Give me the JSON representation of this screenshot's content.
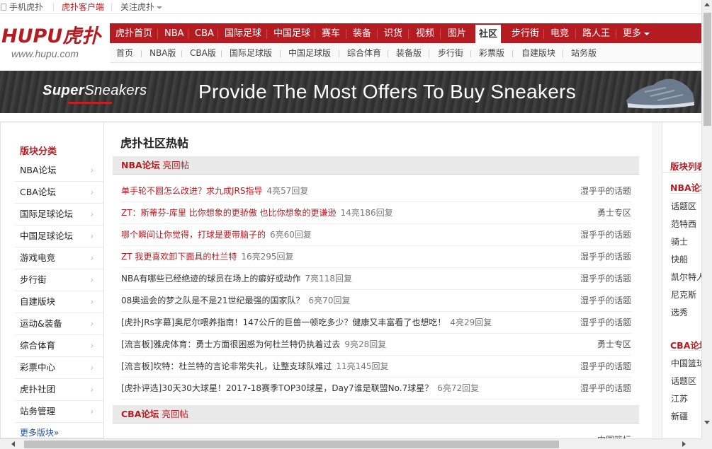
{
  "topbar": {
    "mobile": "手机虎扑",
    "client": "虎扑客户端",
    "follow": "关注虎扑"
  },
  "logo": {
    "main": "HUPU虎扑",
    "url": "www.hupu.com"
  },
  "nav_main": [
    {
      "label": "虎扑首页"
    },
    {
      "label": "NBA"
    },
    {
      "label": "CBA"
    },
    {
      "label": "国际足球"
    },
    {
      "label": "中国足球"
    },
    {
      "label": "赛车"
    },
    {
      "label": "装备"
    },
    {
      "label": "识货"
    },
    {
      "label": "视频"
    },
    {
      "label": "图片"
    },
    {
      "label": "社区"
    },
    {
      "label": "步行街"
    },
    {
      "label": "电竞"
    },
    {
      "label": "路人王"
    },
    {
      "label": "更多"
    }
  ],
  "nav_sub": [
    {
      "label": "首页"
    },
    {
      "label": "NBA版"
    },
    {
      "label": "CBA版"
    },
    {
      "label": "国际足球版"
    },
    {
      "label": "中国足球版"
    },
    {
      "label": "综合体育"
    },
    {
      "label": "装备版"
    },
    {
      "label": "步行街"
    },
    {
      "label": "彩票版"
    },
    {
      "label": "自建版块"
    },
    {
      "label": "站务版"
    }
  ],
  "banner": {
    "brand_bold": "Super",
    "brand_rest": "Sneakers",
    "slogan": "Provide The Most Offers To Buy Sneakers"
  },
  "sidebar": {
    "title": "版块分类",
    "items": [
      {
        "label": "NBA论坛"
      },
      {
        "label": "CBA论坛"
      },
      {
        "label": "国际足球论坛"
      },
      {
        "label": "中国足球论坛"
      },
      {
        "label": "游戏电竞"
      },
      {
        "label": "步行街"
      },
      {
        "label": "自建版块"
      },
      {
        "label": "运动&装备"
      },
      {
        "label": "综合体育"
      },
      {
        "label": "彩票中心"
      },
      {
        "label": "虎扑社团"
      },
      {
        "label": "站务管理"
      }
    ],
    "more": "更多版块»"
  },
  "main": {
    "heading": "虎扑社区热帖",
    "section1": {
      "forum": "NBA论坛",
      "sub": "亮回帖"
    },
    "posts": [
      {
        "title": "单手轮不圆怎么改进？求九成JRS指导",
        "stats": "4亮57回复",
        "board": "湿乎乎的话题"
      },
      {
        "title": "ZT：斯蒂芬-库里 比你想象的更骄傲 也比你想象的更谦逊",
        "stats": "14亮186回复",
        "board": "勇士专区"
      },
      {
        "title": "哪个瞬间让你觉得，打球是要带脑子的",
        "stats": "6亮60回复",
        "board": "湿乎乎的话题"
      },
      {
        "title": "ZT 我更喜欢卸下面具的杜兰特",
        "stats": "16亮295回复",
        "board": "湿乎乎的话题"
      },
      {
        "title": "NBA有哪些已经绝迹的球员在场上的癖好或动作",
        "stats": "7亮118回复",
        "board": "湿乎乎的话题"
      },
      {
        "title": "08奥运会的梦之队是不是21世纪最强的国家队？",
        "stats": "6亮70回复",
        "board": "湿乎乎的话题"
      },
      {
        "title": "[虎扑JRs字幕]奥尼尔喂养指南！147公斤的巨兽一顿吃多少？健康又丰富看了也想吃！",
        "stats": "4亮29回复",
        "board": "湿乎乎的话题"
      },
      {
        "title": "[流言板]雅虎体育：勇士方面很困惑为何杜兰特仍执着过去",
        "stats": "9亮28回复",
        "board": "勇士专区"
      },
      {
        "title": "[流言板]坎特：杜兰特的言论非常失礼，让整支球队难过",
        "stats": "11亮145回复",
        "board": "湿乎乎的话题"
      },
      {
        "title": "[虎扑评选]30天30大球星！2017-18赛季TOP30球星，Day7谁是联盟No.7球星？",
        "stats": "6亮72回复",
        "board": "湿乎乎的话题"
      }
    ],
    "section2": {
      "forum": "CBA论坛",
      "sub": "亮回帖"
    },
    "partial_post": {
      "title": "",
      "stats": "",
      "board": "中国篮坛"
    }
  },
  "rightbar": {
    "title": "版块列表",
    "nba_title": "NBA论坛",
    "nba_items": [
      {
        "label": "话题区"
      },
      {
        "label": "范特西"
      },
      {
        "label": "骑士"
      },
      {
        "label": "快船"
      },
      {
        "label": "凯尔特人"
      },
      {
        "label": "尼克斯"
      },
      {
        "label": "选秀"
      }
    ],
    "cba_title": "CBA论坛",
    "cba_items": [
      {
        "label": "中国篮球"
      },
      {
        "label": "话题区"
      },
      {
        "label": "江苏"
      },
      {
        "label": "新疆"
      }
    ]
  },
  "colors": {
    "brand_red": "#b51c22",
    "link_blue": "#1f4e9a"
  }
}
